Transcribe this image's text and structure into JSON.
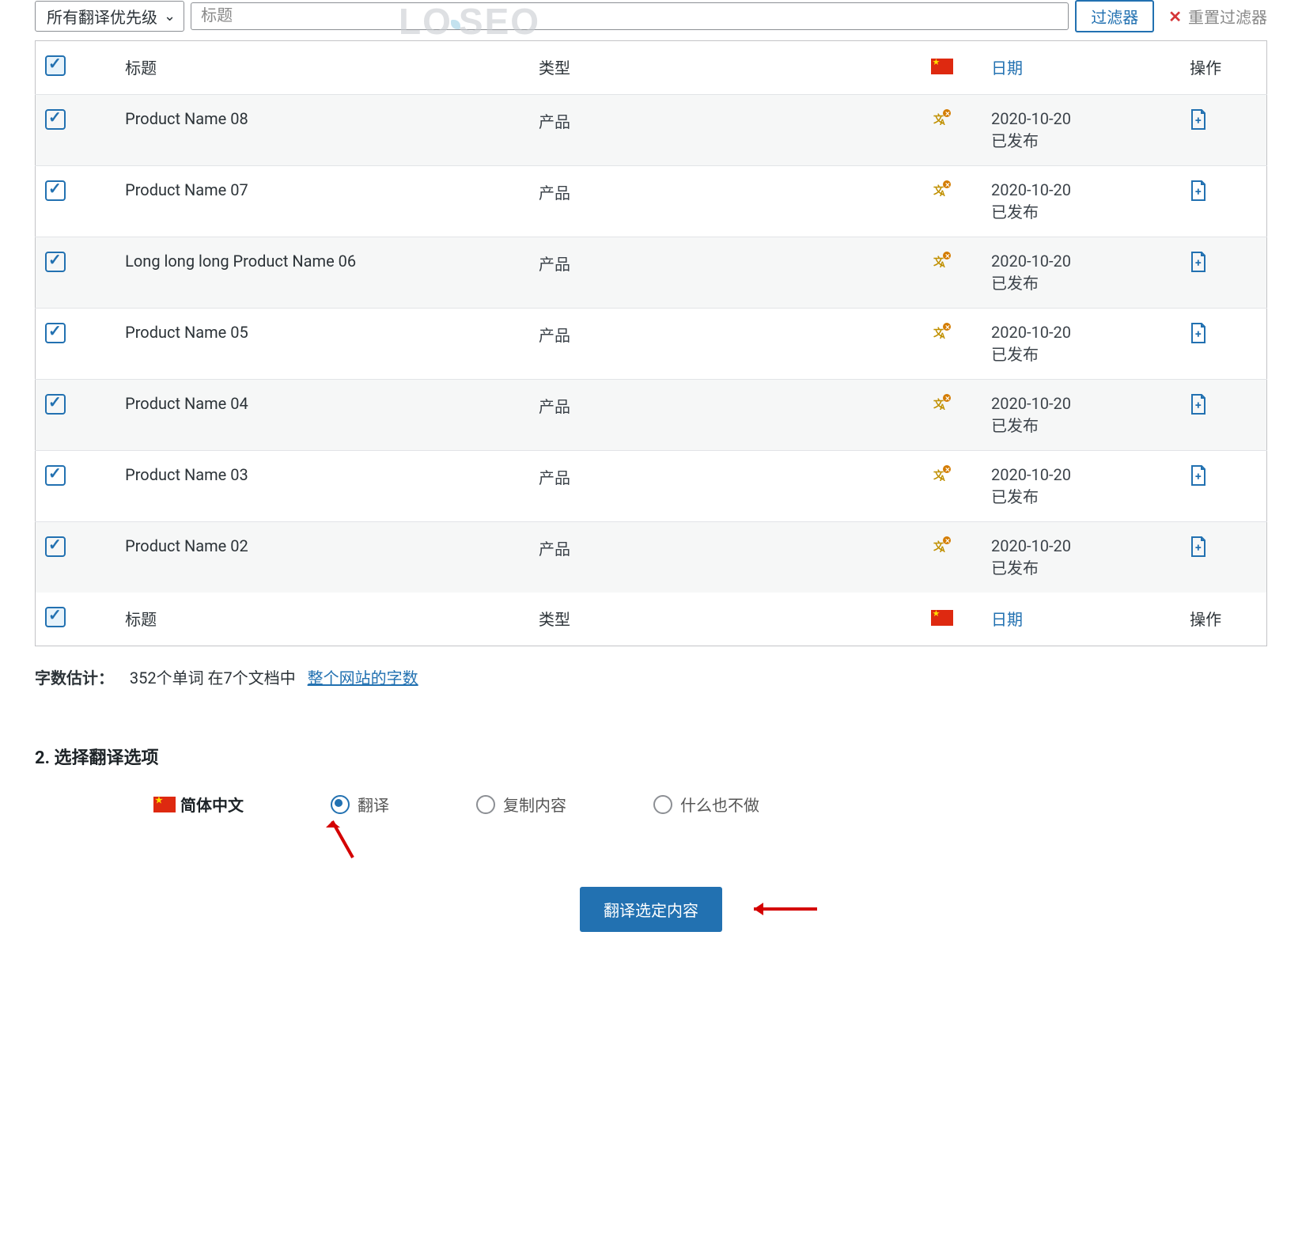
{
  "watermark": "LOYSEO",
  "filters": {
    "priority_label": "所有翻译优先级",
    "title_placeholder": "标题",
    "filter_button": "过滤器",
    "reset_filters": "重置过滤器"
  },
  "table": {
    "header": {
      "title": "标题",
      "type": "类型",
      "date": "日期",
      "op": "操作"
    },
    "footer": {
      "title": "标题",
      "type": "类型",
      "date": "日期",
      "op": "操作"
    },
    "rows": [
      {
        "title": "Product Name 08",
        "type": "产品",
        "date": "2020-10-20",
        "status": "已发布"
      },
      {
        "title": "Product Name 07",
        "type": "产品",
        "date": "2020-10-20",
        "status": "已发布"
      },
      {
        "title": "Long long long Product Name 06",
        "type": "产品",
        "date": "2020-10-20",
        "status": "已发布"
      },
      {
        "title": "Product Name 05",
        "type": "产品",
        "date": "2020-10-20",
        "status": "已发布"
      },
      {
        "title": "Product Name 04",
        "type": "产品",
        "date": "2020-10-20",
        "status": "已发布"
      },
      {
        "title": "Product Name 03",
        "type": "产品",
        "date": "2020-10-20",
        "status": "已发布"
      },
      {
        "title": "Product Name 02",
        "type": "产品",
        "date": "2020-10-20",
        "status": "已发布"
      }
    ]
  },
  "wordcount": {
    "label": "字数估计：",
    "text": "352个单词 在7个文档中",
    "link": "整个网站的字数"
  },
  "options": {
    "section_title": "2. 选择翻译选项",
    "language_label": "简体中文",
    "radios": {
      "translate": "翻译",
      "copy": "复制内容",
      "nothing": "什么也不做"
    }
  },
  "submit": {
    "button": "翻译选定内容"
  }
}
